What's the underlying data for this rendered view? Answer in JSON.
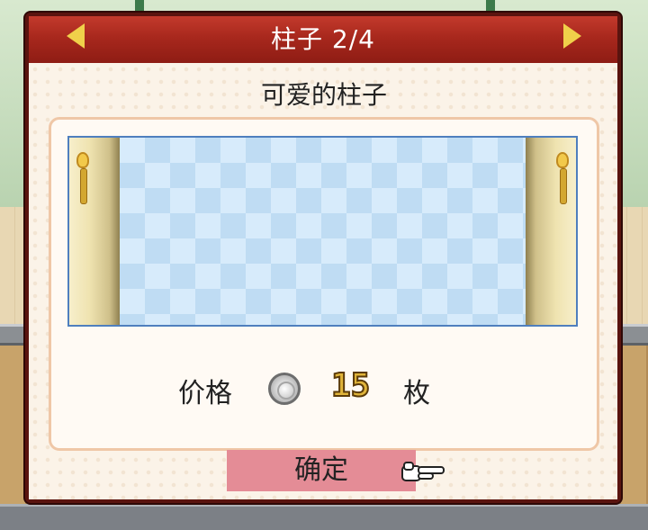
{
  "header": {
    "title": "柱子 2/4",
    "prev_icon": "left-arrow-icon",
    "next_icon": "right-arrow-icon"
  },
  "item": {
    "name": "可爱的柱子"
  },
  "price": {
    "label": "价格",
    "icon": "silver-coin-icon",
    "value": "15",
    "unit": "枚"
  },
  "confirm": {
    "label": "确定",
    "pointer_icon": "pointing-hand-icon"
  },
  "colors": {
    "header_red": "#a8281d",
    "panel_bg": "#fbf3e8",
    "confirm_bg": "#e48c96",
    "arrow_yellow": "#f0d04a",
    "preview_border": "#4f7fbe"
  }
}
